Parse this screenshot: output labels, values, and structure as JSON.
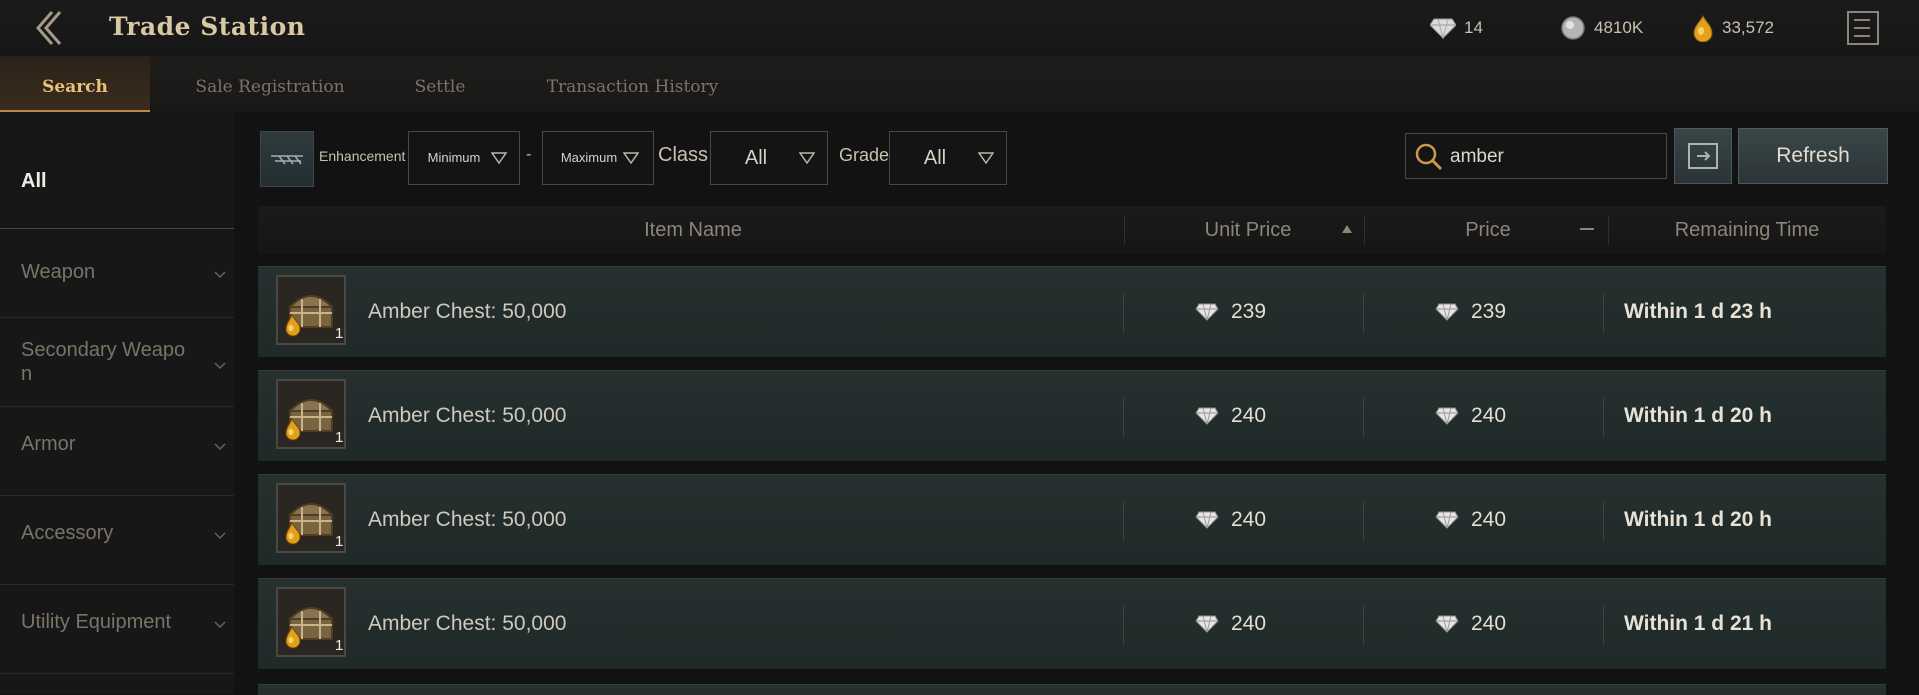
{
  "header": {
    "title": "Trade Station",
    "currencies": [
      {
        "icon": "diamond-icon",
        "value": "14"
      },
      {
        "icon": "silver-coin-icon",
        "value": "4810K"
      },
      {
        "icon": "amber-icon",
        "value": "33,572"
      }
    ]
  },
  "tabs": [
    {
      "label": "Search",
      "active": true
    },
    {
      "label": "Sale Registration",
      "active": false
    },
    {
      "label": "Settle",
      "active": false
    },
    {
      "label": "Transaction History",
      "active": false
    }
  ],
  "sidebar": {
    "items": [
      {
        "label": "All",
        "active": true
      },
      {
        "label": "Weapon"
      },
      {
        "label": "Secondary Weapo\nn"
      },
      {
        "label": "Armor"
      },
      {
        "label": "Accessory"
      },
      {
        "label": "Utility Equipment"
      }
    ]
  },
  "filters": {
    "enhancement_label": "Enhancement",
    "minimum": "Minimum",
    "dash": "-",
    "maximum": "Maximum",
    "class_label": "Class",
    "class_value": "All",
    "grade_label": "Grade",
    "grade_value": "All",
    "search_value": "amber",
    "refresh_label": "Refresh"
  },
  "table": {
    "headers": {
      "item_name": "Item Name",
      "unit_price": "Unit Price",
      "price": "Price",
      "remaining_time": "Remaining Time"
    },
    "rows": [
      {
        "name": "Amber Chest: 50,000",
        "qty": "1",
        "unit_price": "239",
        "price": "239",
        "time": "Within 1 d 23 h"
      },
      {
        "name": "Amber Chest: 50,000",
        "qty": "1",
        "unit_price": "240",
        "price": "240",
        "time": "Within 1 d 20 h"
      },
      {
        "name": "Amber Chest: 50,000",
        "qty": "1",
        "unit_price": "240",
        "price": "240",
        "time": "Within 1 d 20 h"
      },
      {
        "name": "Amber Chest: 50,000",
        "qty": "1",
        "unit_price": "240",
        "price": "240",
        "time": "Within 1 d 21 h"
      }
    ]
  },
  "colors": {
    "accent": "#e8c27a",
    "row_bg": "#26302f"
  }
}
